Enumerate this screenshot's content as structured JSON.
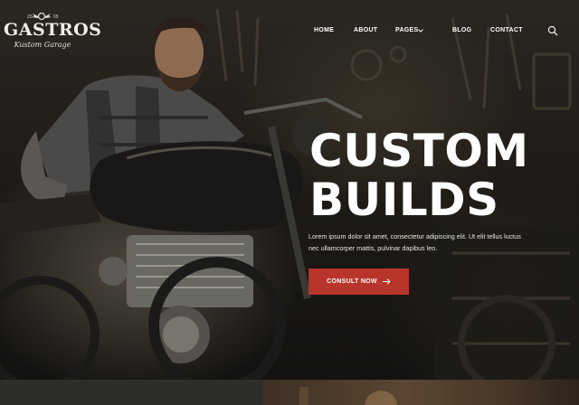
{
  "brand": {
    "name": "GASTROS",
    "tagline": "Kustom Garage",
    "year_left": "20",
    "year_right": "05"
  },
  "nav": {
    "items": [
      "HOME",
      "ABOUT",
      "PAGES",
      "BLOG",
      "CONTACT"
    ],
    "search_icon": "search-icon",
    "pages_chevron_icon": "chevron-down-icon"
  },
  "hero": {
    "headline_line1": "CUSTOM",
    "headline_line2": "BUILDS",
    "description": "Lorem ipsum dolor sit amet, consectetur adipiscing elit. Ut elit tellus luctus nec ullamcorper mattis, pulvinar dapibus leo.",
    "cta_label": "CONSULT NOW",
    "cta_icon": "arrow-right-icon"
  },
  "colors": {
    "accent": "#b8352b",
    "text": "#ffffff",
    "background": "#141210"
  }
}
